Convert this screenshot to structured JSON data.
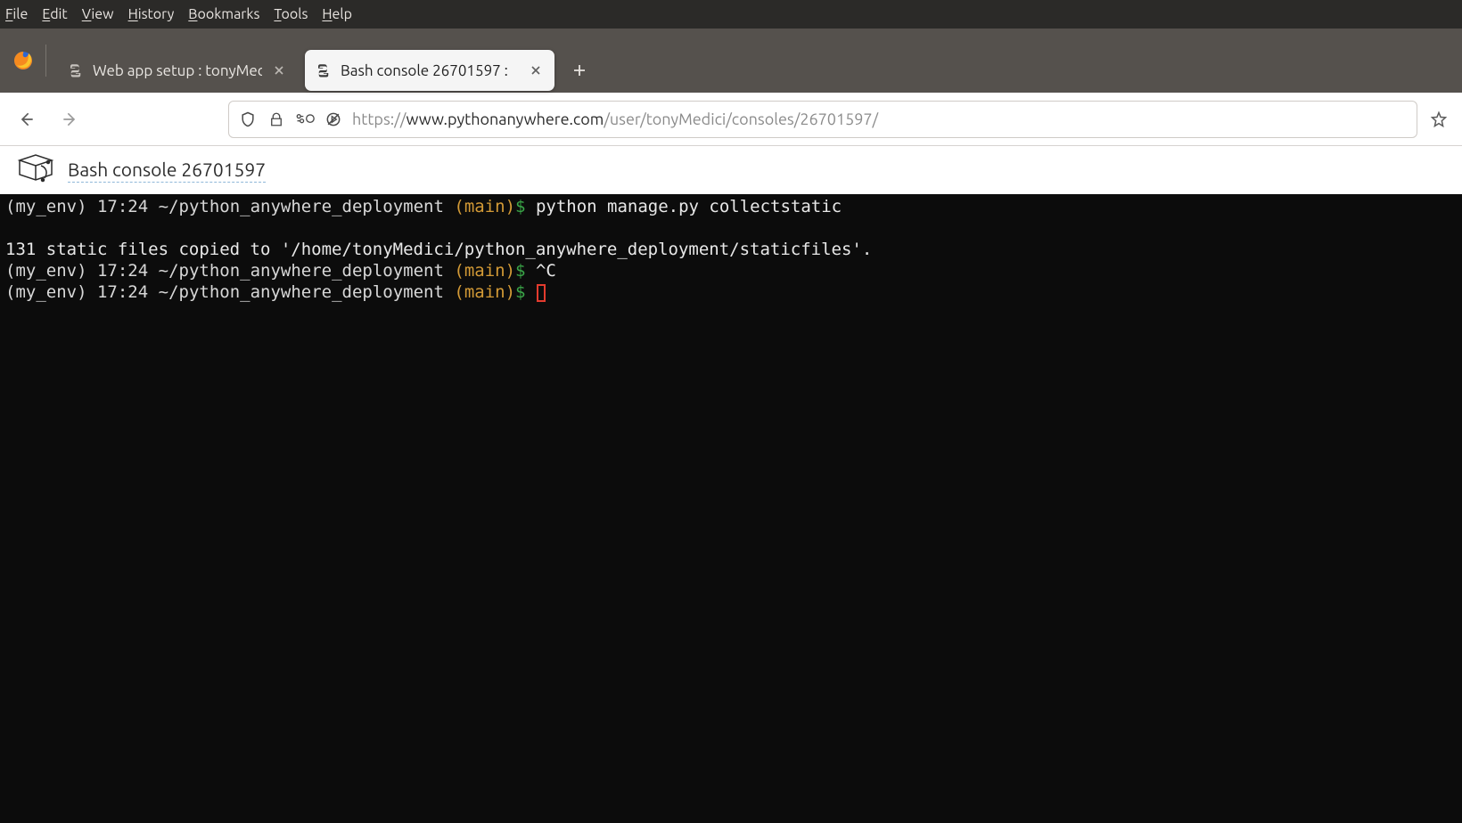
{
  "menubar": {
    "items": [
      {
        "key": "F",
        "rest": "ile"
      },
      {
        "key": "E",
        "rest": "dit"
      },
      {
        "key": "V",
        "rest": "iew"
      },
      {
        "key": "H",
        "rest": "istory"
      },
      {
        "key": "B",
        "rest": "ookmarks"
      },
      {
        "key": "T",
        "rest": "ools"
      },
      {
        "key": "H",
        "rest": "elp"
      }
    ]
  },
  "tabs": {
    "inactive_title": "Web app setup : tonyMec",
    "active_title": "Bash console 26701597 :"
  },
  "url": {
    "protocol": "https://",
    "host": "www.pythonanywhere.com",
    "path": "/user/tonyMedici/consoles/26701597/"
  },
  "page": {
    "console_title": "Bash console 26701597"
  },
  "terminal": {
    "prompt": {
      "env": "(my_env)",
      "time": "17:24",
      "tilde_path": "~/python_anywhere_deployment",
      "branch_open": "(",
      "branch": "main",
      "branch_close": ")",
      "dollar": "$"
    },
    "line1_cmd": "python manage.py collectstatic",
    "output1": "131 static files copied to '/home/tonyMedici/python_anywhere_deployment/staticfiles'.",
    "line2_cmd": "^C",
    "line3_cmd": ""
  }
}
